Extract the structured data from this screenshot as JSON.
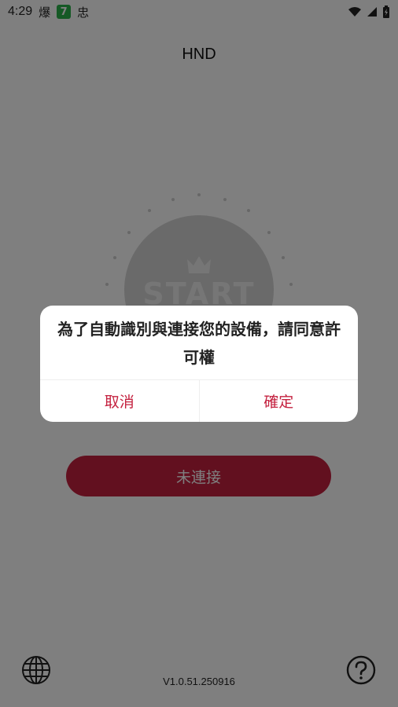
{
  "status_bar": {
    "time": "4:29",
    "notif_1": "爆",
    "notif_2": "7",
    "notif_3": "忠"
  },
  "header": {
    "title": "HND"
  },
  "start": {
    "label": "START"
  },
  "connect_button": {
    "label": "未連接"
  },
  "footer": {
    "version": "V1.0.51.250916"
  },
  "dialog": {
    "message": "為了自動識別與連接您的設備，請同意許可權",
    "cancel_label": "取消",
    "confirm_label": "確定"
  },
  "colors": {
    "accent": "#c4213f",
    "badge_green": "#2bb34a"
  },
  "icons": [
    "wifi-icon",
    "signal-icon",
    "battery-icon",
    "crown-icon",
    "globe-icon",
    "help-icon"
  ]
}
